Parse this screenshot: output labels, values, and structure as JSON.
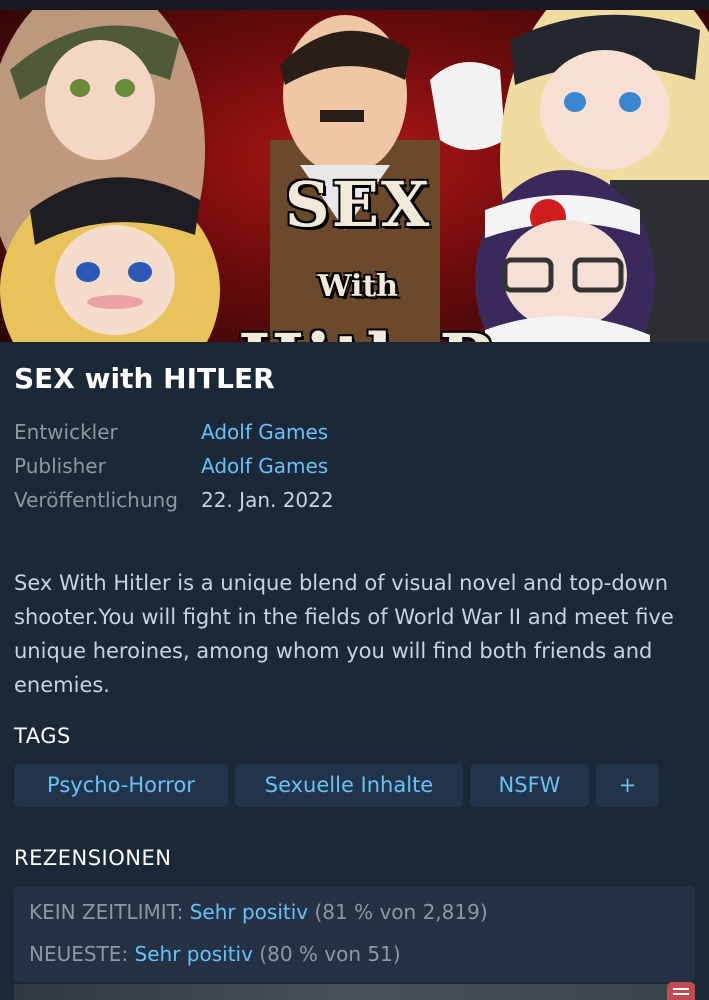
{
  "hero": {
    "logo_line1": "SEX",
    "logo_with": "With",
    "logo_line2": "HitleR"
  },
  "game": {
    "title": "SEX with HITLER",
    "meta": [
      {
        "label": "Entwickler",
        "value": "Adolf Games"
      },
      {
        "label": "Publisher",
        "value": "Adolf Games"
      },
      {
        "label": "Veröffentlichung",
        "value": "22. Jan. 2022"
      }
    ],
    "description": "Sex With Hitler is a unique blend of visual novel and top-down shooter.You will fight in the fields of World War II and meet five unique heroines, among whom you will find both friends and enemies."
  },
  "tags": {
    "heading": "TAGS",
    "items": [
      "Psycho-Horror",
      "Sexuelle Inhalte",
      "NSFW",
      "+"
    ]
  },
  "reviews": {
    "heading": "REZENSIONEN",
    "all_time": {
      "label": "KEIN ZEITLIMIT:",
      "rating": "Sehr positiv",
      "detail": "(81 % von 2,819)"
    },
    "recent": {
      "label": "NEUESTE:",
      "rating": "Sehr positiv",
      "detail": "(80 % von 51)"
    }
  },
  "colors": {
    "background": "#1b2838",
    "link": "#67c1f5",
    "tag_background": "#223449",
    "review_box": "#253245",
    "muted_text": "#8f98a0"
  },
  "icons": [
    "chat-icon"
  ]
}
